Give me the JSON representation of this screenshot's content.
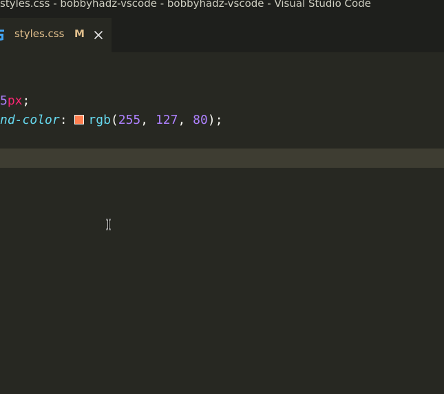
{
  "window": {
    "title": "styles.css - bobbyhadz-vscode - bobbyhadz-vscode - Visual Studio Code"
  },
  "tab": {
    "icon": "css3-icon",
    "label": "styles.css",
    "badge": "M",
    "close_icon": "close-icon"
  },
  "editor": {
    "line1": {
      "value": "5",
      "unit": "px",
      "semicolon": ";"
    },
    "line2": {
      "property": "nd-color",
      "colon": ": ",
      "swatch_color": "#ff7f50",
      "function": "rgb",
      "open_paren": "(",
      "r": "255",
      "sep1": ", ",
      "g": "127",
      "sep2": ", ",
      "b": "80",
      "close_paren": ")",
      "semicolon": ";"
    }
  },
  "colors": {
    "background": "#272822",
    "number": "#ae81ff",
    "unit": "#f92672",
    "property": "#66d9ef",
    "modified": "#e2c08d"
  }
}
